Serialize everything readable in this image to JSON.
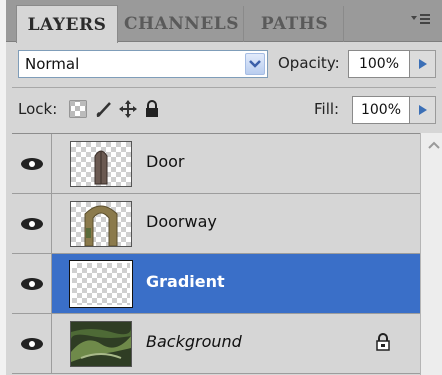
{
  "tabs": [
    {
      "label": "LAYERS",
      "active": true
    },
    {
      "label": "CHANNELS",
      "active": false
    },
    {
      "label": "PATHS",
      "active": false
    }
  ],
  "panel_menu_icon": "panel-menu-icon",
  "blend": {
    "value": "Normal"
  },
  "opacity": {
    "label": "Opacity:",
    "value": "100%"
  },
  "lock": {
    "label": "Lock:",
    "icons": [
      "lock-transparent-pixels-icon",
      "lock-image-pixels-icon",
      "lock-position-icon",
      "lock-all-icon"
    ]
  },
  "fill": {
    "label": "Fill:",
    "value": "100%"
  },
  "layers": [
    {
      "name": "Door",
      "visible": true,
      "selected": false,
      "italic": false,
      "locked": false
    },
    {
      "name": "Doorway",
      "visible": true,
      "selected": false,
      "italic": false,
      "locked": false
    },
    {
      "name": "Gradient",
      "visible": true,
      "selected": true,
      "italic": false,
      "locked": false
    },
    {
      "name": "Background",
      "visible": true,
      "selected": false,
      "italic": true,
      "locked": true
    }
  ],
  "colors": {
    "selection": "#3a6fc8",
    "panel": "#d6d6d6",
    "tabbar": "#9a9a9a"
  }
}
